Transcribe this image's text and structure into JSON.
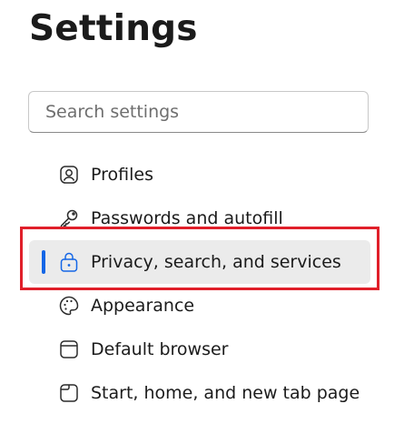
{
  "header": {
    "title": "Settings"
  },
  "search": {
    "placeholder": "Search settings",
    "value": ""
  },
  "sidebar": {
    "items": [
      {
        "label": "Profiles",
        "icon": "profile-icon",
        "selected": false
      },
      {
        "label": "Passwords and autofill",
        "icon": "key-icon",
        "selected": false
      },
      {
        "label": "Privacy, search, and services",
        "icon": "lock-icon",
        "selected": true
      },
      {
        "label": "Appearance",
        "icon": "palette-icon",
        "selected": false
      },
      {
        "label": "Default browser",
        "icon": "browser-icon",
        "selected": false
      },
      {
        "label": "Start, home, and new tab page",
        "icon": "home-page-icon",
        "selected": false
      }
    ]
  },
  "colors": {
    "accent": "#1466e6",
    "selected_background": "#ebebeb",
    "highlight_outline": "#e01f2a"
  }
}
